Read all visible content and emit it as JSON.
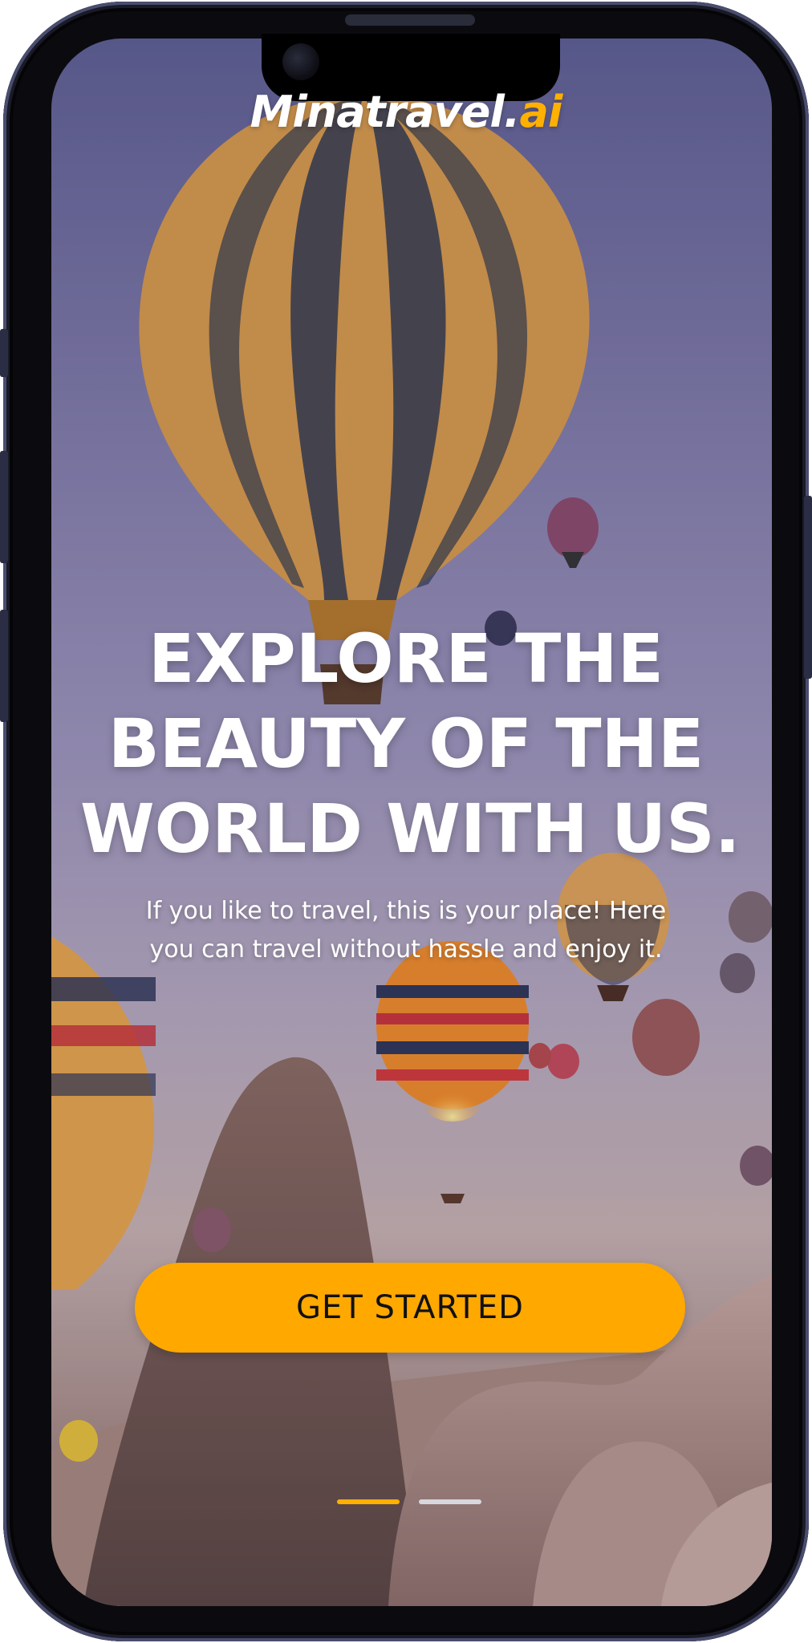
{
  "app": {
    "logo_main": "Minatravel.",
    "logo_accent": "ai"
  },
  "hero": {
    "headline_lines": [
      "EXPLORE THE",
      "BEAUTY OF THE",
      "WORLD WITH US."
    ],
    "subtext_lines": [
      "If you like to travel, this is your place! Here",
      "you can travel without hassle and enjoy it."
    ]
  },
  "cta": {
    "label": "GET STARTED"
  },
  "pager": {
    "total": 2,
    "current": 1
  },
  "colors": {
    "accent": "#ffa800",
    "text": "#ffffff",
    "button_text": "#111111"
  }
}
